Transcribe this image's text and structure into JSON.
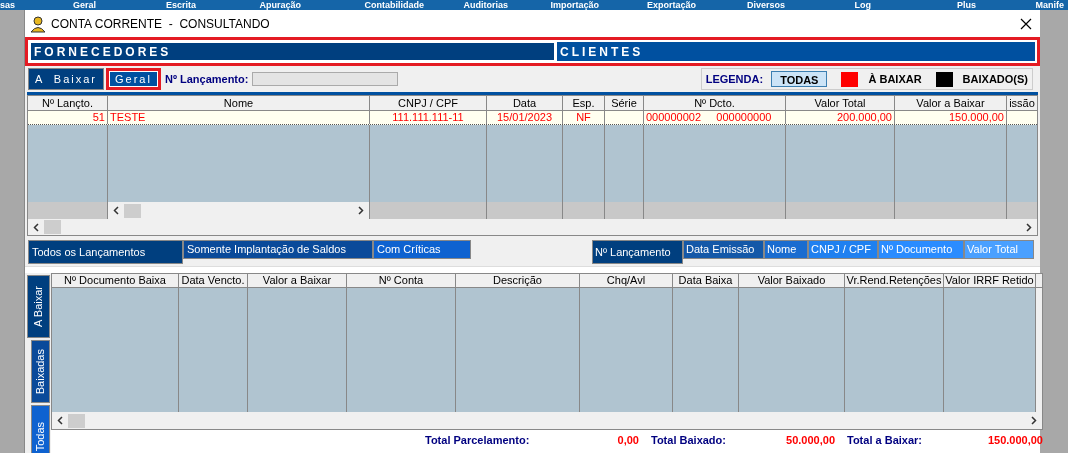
{
  "menu_bar": {
    "items": [
      "sas",
      "Geral",
      "Escrita",
      "Apuração",
      "Contabilidade",
      "Auditorias",
      "Importação",
      "Exportação",
      "Diversos",
      "Log",
      "Plus",
      "Manife"
    ]
  },
  "window": {
    "title": "CONTA CORRENTE  -  CONSULTANDO"
  },
  "party_tabs": [
    {
      "label": "FORNECEDORES",
      "selected": true
    },
    {
      "label": "CLIENTES",
      "selected": false
    }
  ],
  "view_tabs": [
    {
      "label": "A  Baixar",
      "selected": false
    },
    {
      "label": "Geral",
      "selected": true
    }
  ],
  "launch_field": {
    "label": "Nº Lançamento:"
  },
  "legend": {
    "label": "LEGENDA:",
    "button": "TODAS",
    "items": [
      {
        "label": "À BAIXAR",
        "color": "#ff0000"
      },
      {
        "label": "BAIXADO(S)",
        "color": "#000000"
      }
    ]
  },
  "entries_table": {
    "columns": [
      "Nº Lançto.",
      "Nome",
      "CNPJ / CPF",
      "Data",
      "Esp.",
      "Série",
      "Nº Dcto.",
      "Valor Total",
      "Valor a Baixar",
      "issão"
    ],
    "rows": [
      {
        "cells": [
          "51",
          "TESTE",
          "111.111.111-11",
          "15/01/2023",
          "NF",
          "",
          "000000002     000000000",
          "200.000,00",
          "150.000,00",
          ""
        ],
        "selected": true
      }
    ]
  },
  "filter_tabs": [
    {
      "label": "Todos os Lançamentos",
      "selected": true
    },
    {
      "label": "Somente Implantação de Saldos",
      "selected": false
    },
    {
      "label": "Com Críticas",
      "selected": false
    }
  ],
  "sort_tabs": [
    {
      "label": "Nº Lançamento",
      "selected": true
    },
    {
      "label": "Data Emissão",
      "selected": false
    },
    {
      "label": "Nome",
      "selected": false
    },
    {
      "label": "CNPJ / CPF",
      "selected": false
    },
    {
      "label": "Nº Documento",
      "selected": false
    },
    {
      "label": "Valor Total",
      "selected": false
    }
  ],
  "side_tabs": [
    {
      "label": "A Baixar",
      "selected": true
    },
    {
      "label": "Baixadas",
      "selected": false
    },
    {
      "label": "Todas",
      "selected": false
    }
  ],
  "payments_table": {
    "columns": [
      "Nº Documento Baixa",
      "Data Vencto.",
      "Valor a Baixar",
      "Nº Conta",
      "Descrição",
      "Chq/Avl",
      "Data Baixa",
      "Valor Baixado",
      "Vr.Rend.Retenções",
      "Valor IRRF Retido"
    ]
  },
  "totals": [
    {
      "label": "Total Parcelamento:",
      "value": "0,00"
    },
    {
      "label": "Total Baixado:",
      "value": "50.000,00"
    },
    {
      "label": "Total a Baixar:",
      "value": "150.000,00"
    }
  ]
}
